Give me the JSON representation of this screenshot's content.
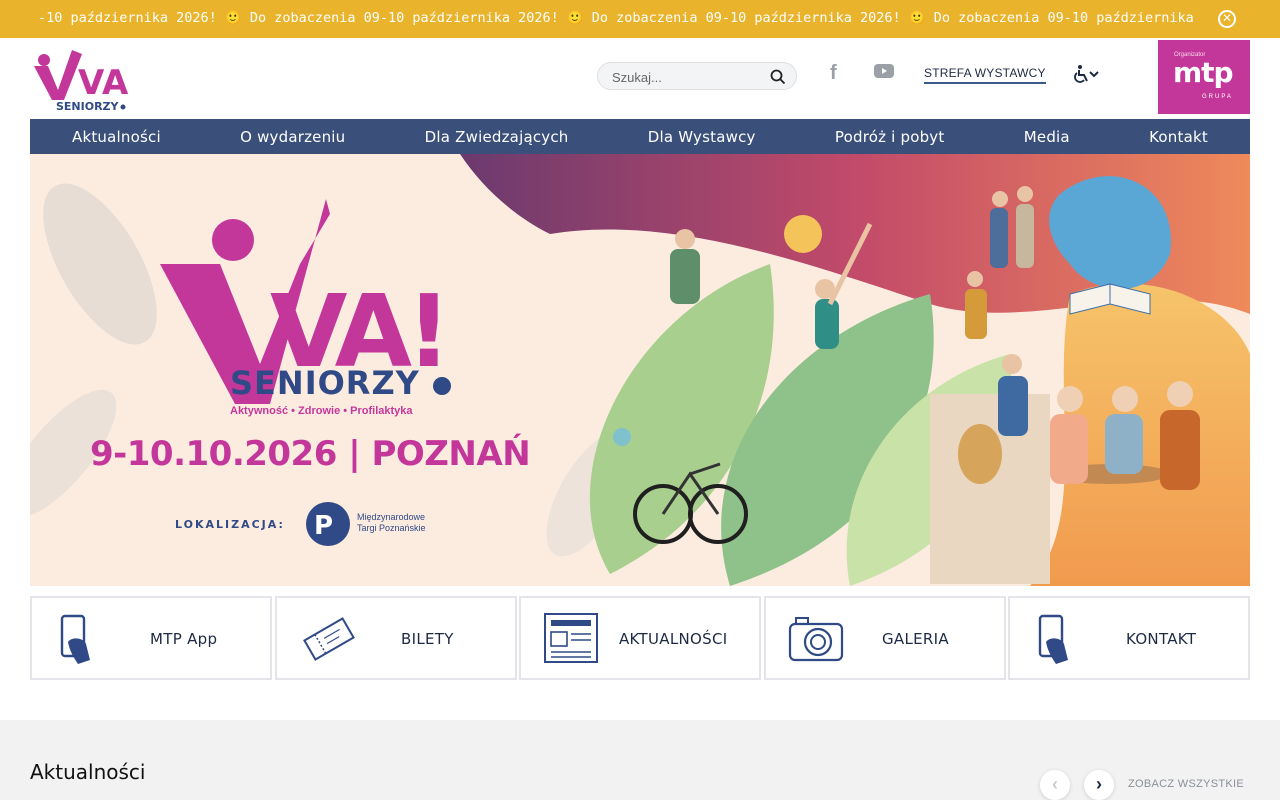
{
  "ticker": {
    "text": "-10 października 2026! 🙂  Do zobaczenia 09-10 października 2026! 🙂  Do zobaczenia 09-10 października 2026! 🙂  Do zobaczenia 09-10 października 2026! 🙂  Do zobaczenia 09-10 października 2026! 🙂  Do zobaczenia 09-"
  },
  "header": {
    "logo_main": "VIVA!",
    "logo_sub": "SENIORZY",
    "search_placeholder": "Szukaj...",
    "exhibitor_zone": "STREFA WYSTAWCY",
    "organizer_label": "Organizator",
    "organizer_name": "mtp",
    "organizer_group": "GRUPA"
  },
  "nav": {
    "items": [
      {
        "label": "Aktualności"
      },
      {
        "label": "O wydarzeniu"
      },
      {
        "label": "Dla Zwiedzających"
      },
      {
        "label": "Dla Wystawcy"
      },
      {
        "label": "Podróż i pobyt"
      },
      {
        "label": "Media"
      },
      {
        "label": "Kontakt"
      }
    ]
  },
  "hero": {
    "brand": "VIVA!",
    "seniorzy": "SENIORZY",
    "tagline": "Aktywność • Zdrowie • Profilaktyka",
    "date_place": "9-10.10.2026 | POZNAŃ",
    "location_label": "LOKALIZACJA:",
    "venue_line1": "Międzynarodowe",
    "venue_line2": "Targi Poznańskie"
  },
  "tiles": [
    {
      "label": "MTP App",
      "icon": "phone-hand-icon"
    },
    {
      "label": "BILETY",
      "icon": "ticket-icon"
    },
    {
      "label": "AKTUALNOŚCI",
      "icon": "newspaper-icon"
    },
    {
      "label": "GALERIA",
      "icon": "camera-icon"
    },
    {
      "label": "KONTAKT",
      "icon": "phone-hand-icon"
    }
  ],
  "news": {
    "title": "Aktualności",
    "see_all": "ZOBACZ WSZYSTKIE"
  },
  "colors": {
    "ticker_bg": "#e9b32c",
    "nav_bg": "#3a4f7a",
    "brand_magenta": "#c4379a",
    "brand_navy": "#2f4a86"
  }
}
